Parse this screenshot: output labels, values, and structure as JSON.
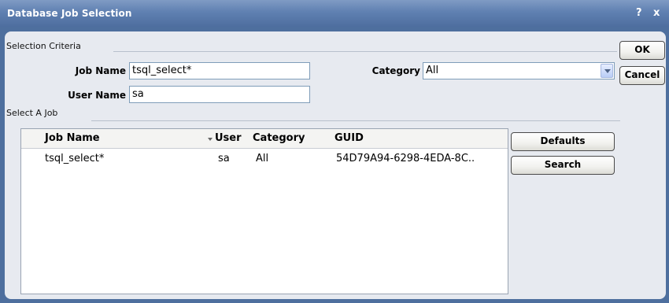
{
  "window": {
    "title": "Database Job Selection",
    "help_label": "?",
    "close_label": "x"
  },
  "criteria": {
    "section_label": "Selection Criteria",
    "job_name_label": "Job Name",
    "job_name_value": "tsql_select*",
    "category_label": "Category",
    "category_value": "All",
    "user_name_label": "User Name",
    "user_name_value": "sa"
  },
  "select_job": {
    "section_label": "Select A Job"
  },
  "table": {
    "columns": [
      "Job Name",
      "User",
      "Category",
      "GUID"
    ],
    "rows": [
      {
        "job_name": "tsql_select*",
        "user": "sa",
        "category": "All",
        "guid": "54D79A94-6298-4EDA-8C.."
      }
    ]
  },
  "buttons": {
    "ok": "OK",
    "cancel": "Cancel",
    "defaults": "Defaults",
    "search": "Search"
  },
  "colors": {
    "titlebar": "#5f80b1",
    "panel": "#e7eaf0",
    "frame": "#4e6f9e"
  }
}
